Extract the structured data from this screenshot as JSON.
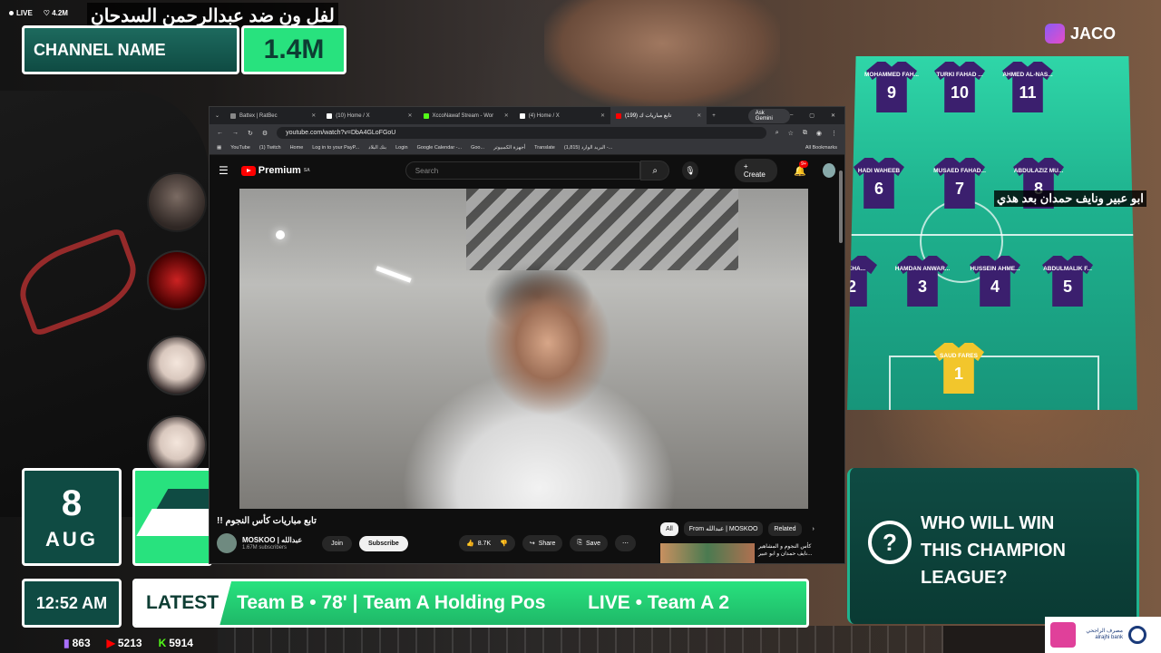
{
  "stream": {
    "live_label": "LIVE",
    "viewers": "4.2M",
    "title_ar": "لفل ون ضد عبدالرحمن السدحان",
    "channel_name": "CHANNEL NAME",
    "channel_count": "1.4M",
    "date_day": "8",
    "date_month": "AUG",
    "time": "12:52 AM",
    "ticker_label": "LATEST",
    "ticker_text": "Team B • 78' | Team A Holding Pos        LIVE • Team A 2",
    "stats": [
      {
        "icon": "twitch-icon",
        "value": "863"
      },
      {
        "icon": "youtube-icon",
        "value": "5213"
      },
      {
        "icon": "kick-icon",
        "value": "5914"
      }
    ],
    "side_caption_ar": "ابو عبير ونايف حمدان بعد هذي",
    "sponsor": "JACO",
    "question_lines": [
      "WHO WILL WIN",
      "THIS CHAMPION",
      "LEAGUE?"
    ],
    "bank_text": "مصرف الراجحي alrajhi bank"
  },
  "browser": {
    "tabs": [
      {
        "label": "Battex | RatBec",
        "active": false
      },
      {
        "label": "(10) Home / X",
        "active": false
      },
      {
        "label": "XccoNawaf Stream - Wor",
        "active": false
      },
      {
        "label": "(4) Home / X",
        "active": false
      },
      {
        "label": "(199) تابع مباريات ك",
        "active": true
      }
    ],
    "gemini_label": "Ask Gemini",
    "url": "youtube.com/watch?v=DbA4GLoFGoU",
    "bookmarks": [
      "YouTube",
      "(1) Twitch",
      "Home",
      "Log in to your PayP...",
      "بنك البلاد",
      "Login",
      "Google Calendar -...",
      "Goo...",
      "أجهزة الكمبيوتر",
      "Translate",
      "(1,815) البريد الوارد -...",
      "All Bookmarks"
    ]
  },
  "youtube": {
    "logo": "Premium",
    "logo_sup": "SA",
    "search_placeholder": "Search",
    "create_label": "Create",
    "notif_badge": "9+",
    "video_title": "!! تابع مباريات كأس النجوم",
    "channel": "MOSKOO | عبدالله",
    "subscribers": "1.67M subscribers",
    "join": "Join",
    "subscribe": "Subscribe",
    "likes": "8.7K",
    "share": "Share",
    "save": "Save",
    "chips": [
      {
        "label": "All",
        "active": true
      },
      {
        "label": "From عبدالله | MOSKOO",
        "active": false
      },
      {
        "label": "Related",
        "active": false
      }
    ],
    "rec_title": "كأس النجوم و المشاهير نايف حمدان و ابو عبير..."
  },
  "lineup": {
    "players": [
      {
        "name": "MOHAMMED FAH...",
        "number": "9"
      },
      {
        "name": "TURKI FAHAD ...",
        "number": "10"
      },
      {
        "name": "AHMED AL-NAS...",
        "number": "11"
      },
      {
        "name": "HADI WAHEEB",
        "number": "6"
      },
      {
        "name": "MUSAED FAHAD...",
        "number": "7"
      },
      {
        "name": "ABDULAZIZ MU...",
        "number": "8"
      },
      {
        "name": "AL-KHA...",
        "number": "2"
      },
      {
        "name": "HAMDAN ANWAR...",
        "number": "3"
      },
      {
        "name": "HUSSEIN AHME...",
        "number": "4"
      },
      {
        "name": "ABDULMALIK F...",
        "number": "5"
      },
      {
        "name": "SAUD FARES",
        "number": "1"
      }
    ]
  }
}
